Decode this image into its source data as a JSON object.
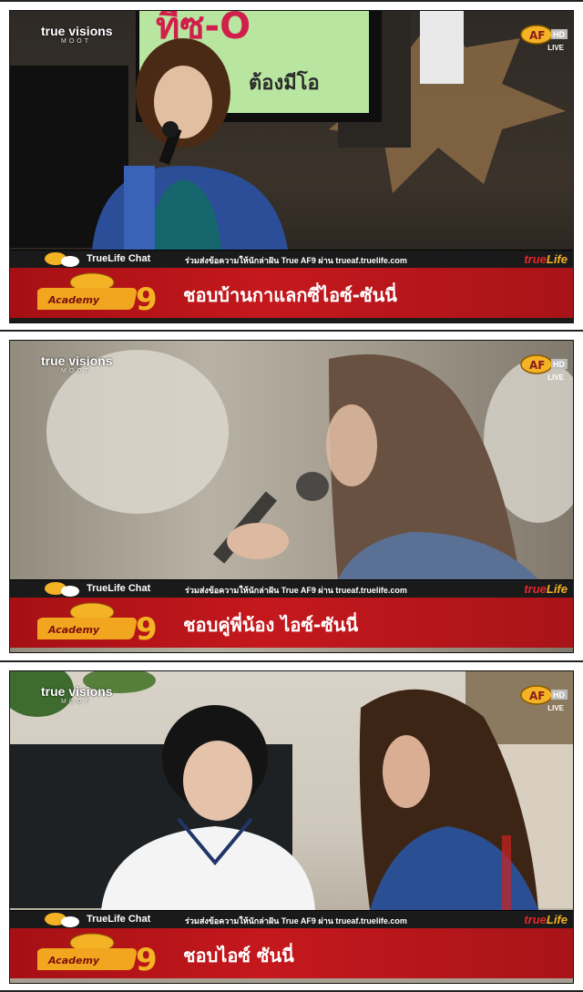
{
  "frames": [
    {
      "watermark": {
        "brand": "true visions",
        "sub": "MOOT"
      },
      "channel": {
        "live": "LIVE"
      },
      "ticker": {
        "chat_label": "TrueLife Chat",
        "info": "ร่วมส่งข้อความให้นักล่าฝัน True AF9 ผ่าน trueaf.truelife.com",
        "brand": "trueLife",
        "message": "ชอบบ้านกาแลกซี่ไอซ์-ซันนี่"
      },
      "background_sign": "ต้องมีโอ"
    },
    {
      "watermark": {
        "brand": "true visions",
        "sub": "MOOT"
      },
      "channel": {
        "live": "LIVE"
      },
      "ticker": {
        "chat_label": "TrueLife Chat",
        "info": "ร่วมส่งข้อความให้นักล่าฝัน True AF9 ผ่าน trueaf.truelife.com",
        "brand": "trueLife",
        "message": "ชอบคู่พี่น้อง ไอซ์-ซันนี่"
      }
    },
    {
      "watermark": {
        "brand": "true visions",
        "sub": "MOOT"
      },
      "channel": {
        "live": "LIVE"
      },
      "ticker": {
        "chat_label": "TrueLife Chat",
        "info": "ร่วมส่งข้อความให้นักล่าฝัน True AF9 ผ่าน trueaf.truelife.com",
        "brand": "trueLife",
        "message": "ชอบไอซ์ ซันนี่"
      }
    }
  ],
  "colors": {
    "ticker_red": "#c4181d",
    "brand_red": "#e8262a",
    "brand_gold": "#f3b324"
  }
}
